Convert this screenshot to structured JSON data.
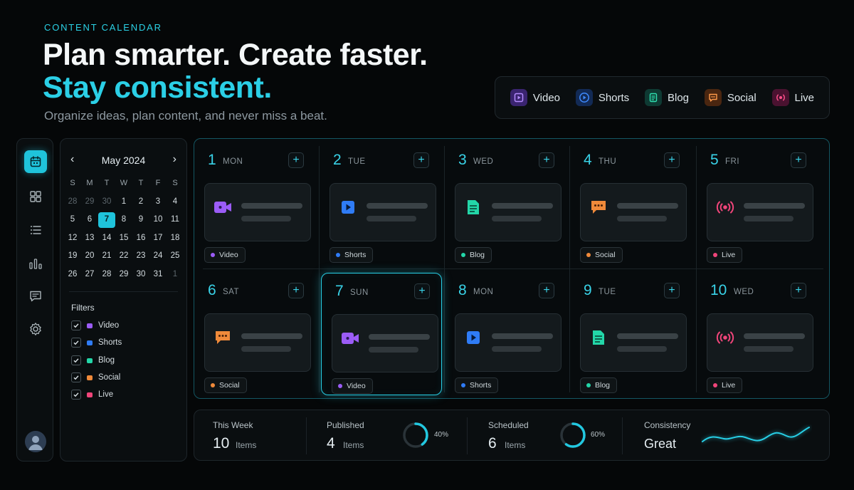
{
  "header": {
    "eyebrow": "CONTENT CALENDAR",
    "headline_line1": "Plan smarter. Create faster.",
    "headline_line2": "Stay consistent.",
    "subhead": "Organize ideas, plan content, and never miss a beat."
  },
  "colors": {
    "accent": "#1fc3db",
    "video": "#9b5cf6",
    "shorts": "#2f7cf6",
    "blog": "#23d6a8",
    "social": "#f08a3a",
    "live": "#f0457a"
  },
  "legend": [
    {
      "label": "Video",
      "icon": "video-icon"
    },
    {
      "label": "Shorts",
      "icon": "shorts-icon"
    },
    {
      "label": "Blog",
      "icon": "blog-icon"
    },
    {
      "label": "Social",
      "icon": "social-icon"
    },
    {
      "label": "Live",
      "icon": "live-icon"
    }
  ],
  "sidebar": {
    "items": [
      "calendar-icon",
      "grid-icon",
      "list-icon",
      "chart-icon",
      "messages-icon",
      "settings-icon"
    ],
    "active": "calendar-icon"
  },
  "mini_calendar": {
    "prev": "‹",
    "next": "›",
    "month": "May 2024",
    "weekdays": [
      "S",
      "M",
      "T",
      "W",
      "T",
      "F",
      "S"
    ],
    "weeks": [
      [
        "28",
        "29",
        "30",
        "1",
        "2",
        "3",
        "4"
      ],
      [
        "5",
        "6",
        "7",
        "8",
        "9",
        "10",
        "11"
      ],
      [
        "12",
        "13",
        "14",
        "15",
        "16",
        "17",
        "18"
      ],
      [
        "19",
        "20",
        "21",
        "22",
        "23",
        "24",
        "25"
      ],
      [
        "26",
        "27",
        "28",
        "29",
        "30",
        "31",
        "1"
      ]
    ],
    "selected": "7"
  },
  "filters": {
    "title": "Filters",
    "items": [
      "Video",
      "Shorts",
      "Blog",
      "Social",
      "Live"
    ]
  },
  "days": [
    {
      "num": "1",
      "dow": "MON",
      "type": "Video",
      "plus": "+"
    },
    {
      "num": "2",
      "dow": "TUE",
      "type": "Shorts",
      "plus": "+"
    },
    {
      "num": "3",
      "dow": "WED",
      "type": "Blog",
      "plus": "+"
    },
    {
      "num": "4",
      "dow": "THU",
      "type": "Social",
      "plus": "+"
    },
    {
      "num": "5",
      "dow": "FRI",
      "type": "Live",
      "plus": "+"
    },
    {
      "num": "6",
      "dow": "SAT",
      "type": "Social",
      "plus": "+"
    },
    {
      "num": "7",
      "dow": "SUN",
      "type": "Video",
      "plus": "+"
    },
    {
      "num": "8",
      "dow": "MON",
      "type": "Shorts",
      "plus": "+"
    },
    {
      "num": "9",
      "dow": "TUE",
      "type": "Blog",
      "plus": "+"
    },
    {
      "num": "10",
      "dow": "WED",
      "type": "Live",
      "plus": "+"
    }
  ],
  "stats": {
    "this_week": {
      "label": "This Week",
      "value": "10",
      "unit": "Items"
    },
    "published": {
      "label": "Published",
      "value": "4",
      "unit": "Items",
      "percent": "40%",
      "fraction": 0.4
    },
    "scheduled": {
      "label": "Scheduled",
      "value": "6",
      "unit": "Items",
      "percent": "60%",
      "fraction": 0.6
    },
    "consistency": {
      "label": "Consistency",
      "value": "Great"
    }
  }
}
